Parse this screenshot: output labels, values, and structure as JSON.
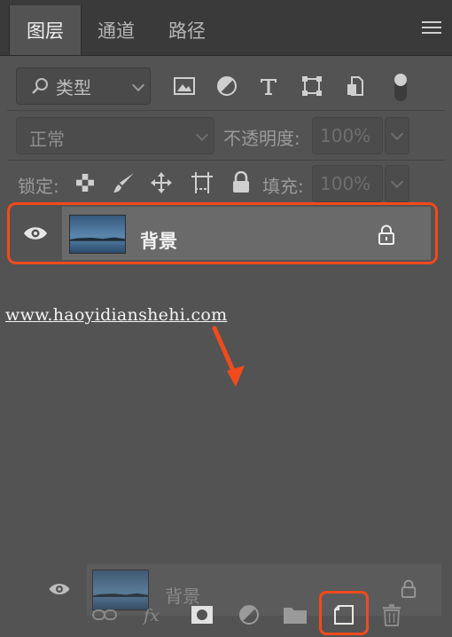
{
  "tabs": {
    "layers": "图层",
    "channels": "通道",
    "paths": "路径"
  },
  "filter": {
    "kind_label": "类型"
  },
  "blend": {
    "mode": "正常",
    "opacity_label": "不透明度:",
    "opacity_value": "100%"
  },
  "lock": {
    "label": "锁定:",
    "fill_label": "填充:",
    "fill_value": "100%"
  },
  "layers": [
    {
      "name": "背景"
    }
  ],
  "ghost_layer": {
    "name": "背景"
  },
  "watermark": "www.haoyidianshehi.com",
  "colors": {
    "panel_bg": "#535353",
    "selected_row": "#6a6a6a",
    "highlight": "#f24a1c"
  },
  "icons": [
    "panel-menu-icon",
    "search-icon",
    "image-filter-icon",
    "adjustment-filter-icon",
    "type-filter-icon",
    "shape-filter-icon",
    "smart-object-filter-icon",
    "filter-toggle-icon",
    "lock-transparent-icon",
    "lock-paint-icon",
    "lock-position-icon",
    "lock-artboard-icon",
    "lock-all-icon",
    "eye-icon",
    "layer-lock-icon",
    "link-icon",
    "fx-icon",
    "mask-icon",
    "adjustment-icon",
    "group-folder-icon",
    "new-layer-icon",
    "trash-icon"
  ]
}
